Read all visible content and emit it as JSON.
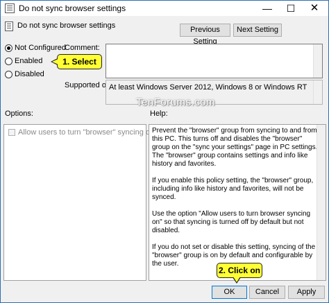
{
  "window": {
    "title": "Do not sync browser settings",
    "minimize_glyph": "—",
    "maximize_glyph": "☐",
    "close_glyph": "✕"
  },
  "header": {
    "policy_name": "Do not sync browser settings",
    "previous_label": "Previous Setting",
    "next_label": "Next Setting"
  },
  "state": {
    "options": [
      {
        "label": "Not Configured",
        "checked": true
      },
      {
        "label": "Enabled",
        "checked": false
      },
      {
        "label": "Disabled",
        "checked": false
      }
    ]
  },
  "comment": {
    "label": "Comment:",
    "value": ""
  },
  "supported": {
    "label": "Supported on:",
    "value": "At least Windows Server 2012, Windows 8 or Windows RT"
  },
  "watermark": "TenForums.com",
  "options_pane": {
    "label": "Options:",
    "checkbox_label": "Allow users to turn \"browser\" syncing on."
  },
  "help_pane": {
    "label": "Help:",
    "paragraphs": [
      "Prevent the \"browser\" group from syncing to and from this PC. This turns off and disables the \"browser\" group on the \"sync your settings\" page in PC settings. The \"browser\" group contains settings and info like history and favorites.",
      "If you enable this policy setting, the \"browser\" group, including info like history and favorites, will not be synced.",
      "Use the option \"Allow users to turn browser syncing on\" so that syncing is turned off by default but not disabled.",
      "If you do not set or disable this setting, syncing of the \"browser\" group is on by default and configurable by the user."
    ]
  },
  "footer": {
    "ok_label": "OK",
    "cancel_label": "Cancel",
    "apply_label": "Apply"
  },
  "callouts": {
    "select": "1. Select",
    "click": "2. Click on"
  },
  "colors": {
    "callout": "#ffff33",
    "ok_border": "#0078d7",
    "window_border": "#2b6fb5"
  }
}
